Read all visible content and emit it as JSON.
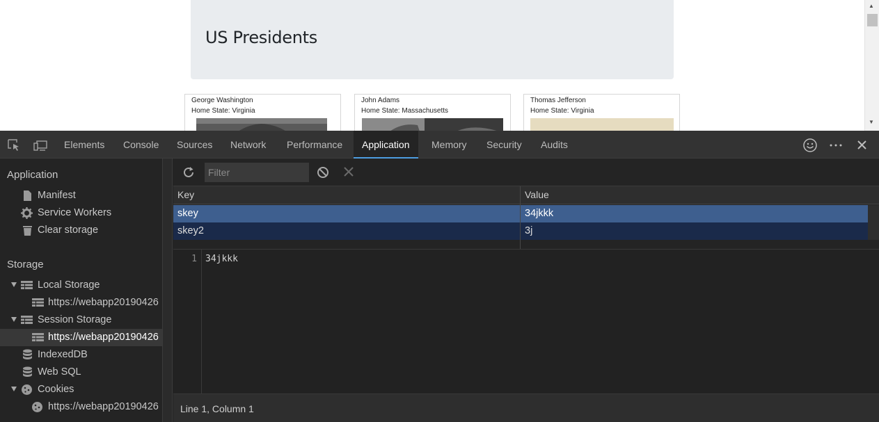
{
  "page": {
    "heading": "US Presidents",
    "cards": [
      {
        "name": "George Washington",
        "state": "Home State: Virginia"
      },
      {
        "name": "John Adams",
        "state": "Home State: Massachusetts"
      },
      {
        "name": "Thomas Jefferson",
        "state": "Home State: Virginia"
      }
    ]
  },
  "devtools": {
    "tabs": [
      "Elements",
      "Console",
      "Sources",
      "Network",
      "Performance",
      "Application",
      "Memory",
      "Security",
      "Audits"
    ],
    "active_tab": "Application",
    "accent_color": "#4d9de0",
    "sidebar": {
      "application_title": "Application",
      "application_items": [
        "Manifest",
        "Service Workers",
        "Clear storage"
      ],
      "storage_title": "Storage",
      "local_storage": "Local Storage",
      "local_storage_origin": "https://webapp20190426",
      "session_storage": "Session Storage",
      "session_storage_origin": "https://webapp20190426",
      "indexeddb": "IndexedDB",
      "websql": "Web SQL",
      "cookies": "Cookies",
      "cookies_origin": "https://webapp20190426"
    },
    "toolbar": {
      "filter_placeholder": "Filter"
    },
    "grid": {
      "columns": [
        "Key",
        "Value"
      ],
      "rows": [
        {
          "key": "skey",
          "value": "34jkkk"
        },
        {
          "key": "skey2",
          "value": "3j"
        }
      ]
    },
    "preview": {
      "line_number": "1",
      "content": "34jkkk"
    },
    "status": "Line 1, Column 1"
  }
}
